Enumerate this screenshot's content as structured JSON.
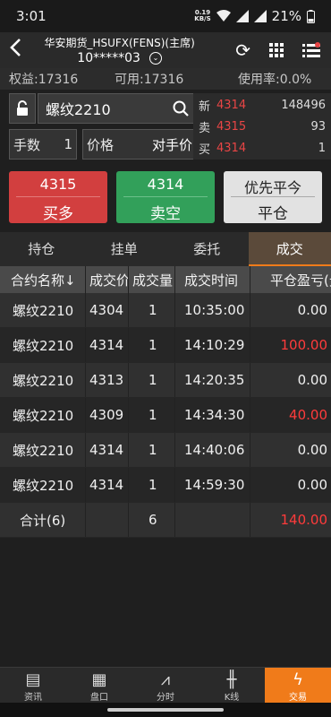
{
  "statusbar": {
    "time": "3:01",
    "net_speed": "0.19",
    "net_unit": "KB/S",
    "battery": "21%"
  },
  "header": {
    "title": "华安期货_HSUFX(FENS)(主席)",
    "account_id": "10*****03"
  },
  "stats": {
    "equity": "权益:17316",
    "available": "可用:17316",
    "usage": "使用率:0.0%"
  },
  "entry": {
    "contract": "螺纹2210",
    "qty_label": "手数",
    "qty_value": "1",
    "price_label": "价格",
    "price_value": "对手价"
  },
  "quote": {
    "new_label": "新",
    "new_price": "4314",
    "new_vol": "148496",
    "ask_label": "卖",
    "ask_price": "4315",
    "ask_vol": "93",
    "bid_label": "买",
    "bid_price": "4314",
    "bid_vol": "1"
  },
  "actions": {
    "buy_price": "4315",
    "buy_label": "买多",
    "sell_price": "4314",
    "sell_label": "卖空",
    "close_top": "优先平今",
    "close_label": "平仓"
  },
  "tabs": [
    "持仓",
    "挂单",
    "委托",
    "成交"
  ],
  "table": {
    "headers": [
      "合约名称↓",
      "成交价",
      "成交量",
      "成交时间",
      "平仓盈亏(元)"
    ],
    "rows": [
      [
        "螺纹2210",
        "4304",
        "1",
        "10:35:00",
        "0.00"
      ],
      [
        "螺纹2210",
        "4314",
        "1",
        "14:10:29",
        "100.00"
      ],
      [
        "螺纹2210",
        "4313",
        "1",
        "14:20:35",
        "0.00"
      ],
      [
        "螺纹2210",
        "4309",
        "1",
        "14:34:30",
        "40.00"
      ],
      [
        "螺纹2210",
        "4314",
        "1",
        "14:40:06",
        "0.00"
      ],
      [
        "螺纹2210",
        "4314",
        "1",
        "14:59:30",
        "0.00"
      ]
    ],
    "total": {
      "label": "合计(6)",
      "qty": "6",
      "pnl": "140.00"
    }
  },
  "bottomnav": [
    "资讯",
    "盘口",
    "分时",
    "K线",
    "交易"
  ],
  "colors": {
    "accent": "#f07b1a",
    "buy": "#d23f3f",
    "sell": "#32a05a",
    "loss_profit_red": "#ff3b3b"
  }
}
